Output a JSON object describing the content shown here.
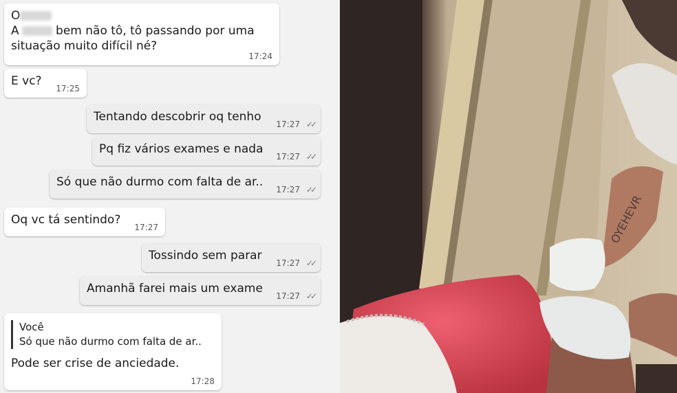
{
  "chat": {
    "messages": [
      {
        "sender": "other",
        "name_prefix": "O",
        "line1_prefix": "A",
        "line1_rest": " bem não tô, tô passando por uma",
        "line2": "situação muito difícil né?",
        "time": "17:24"
      },
      {
        "sender": "other",
        "text": "E vc?",
        "time": "17:25"
      },
      {
        "sender": "me",
        "text": "Tentando descobrir oq tenho",
        "time": "17:27"
      },
      {
        "sender": "me",
        "text": "Pq fiz vários exames e nada",
        "time": "17:27"
      },
      {
        "sender": "me",
        "text": "Só que não durmo com falta de ar..",
        "time": "17:27"
      },
      {
        "sender": "other",
        "text": "Oq vc tá sentindo?",
        "time": "17:27"
      },
      {
        "sender": "me",
        "text": "Tossindo sem parar",
        "time": "17:27"
      },
      {
        "sender": "me",
        "text": "Amanhã farei mais um exame",
        "time": "17:27"
      },
      {
        "sender": "other",
        "quote_author": "Você",
        "quote_text": "Só que não durmo com falta de ar..",
        "text": "Pode ser crise de anciedade.",
        "time": "17:28"
      }
    ],
    "tick_glyph": "✓✓"
  },
  "photo": {
    "tattoo_text": "OYEHEVR"
  },
  "colors": {
    "chat_bg": "#f2f2f2",
    "bubble_in": "#ffffff",
    "bubble_out": "#ededed",
    "pink_garment": "#d84a5a",
    "wall": "#c9b79e"
  }
}
